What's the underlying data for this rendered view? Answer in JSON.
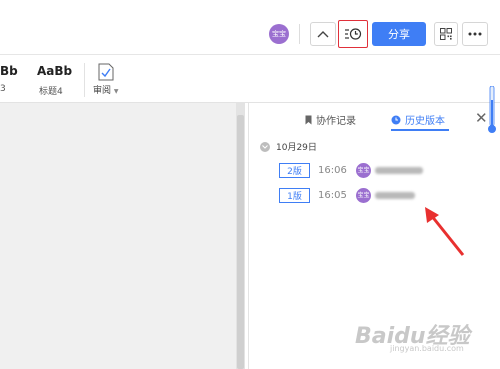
{
  "header": {
    "user_avatar_text": "宝宝",
    "share_label": "分享"
  },
  "toolbar": {
    "styles": [
      {
        "preview": "Bb",
        "label": "3"
      },
      {
        "preview": "AaBb",
        "label": "标题4"
      }
    ],
    "review_label": "审阅"
  },
  "panel": {
    "tabs": [
      {
        "label": "协作记录",
        "icon": "bookmark-icon",
        "active": false
      },
      {
        "label": "历史版本",
        "icon": "clock-icon",
        "active": true
      }
    ],
    "date_group": "10月29日",
    "versions": [
      {
        "badge": "2版",
        "time": "16:06",
        "avatar": "宝宝"
      },
      {
        "badge": "1版",
        "time": "16:05",
        "avatar": "宝宝"
      }
    ]
  },
  "watermark": {
    "brand": "Baidu经验",
    "url": "jingyan.baidu.com"
  },
  "colors": {
    "accent": "#3f7ef5",
    "avatar": "#9b6fd0",
    "highlight_border": "#e0303a",
    "annotation_arrow": "#e8302f"
  }
}
